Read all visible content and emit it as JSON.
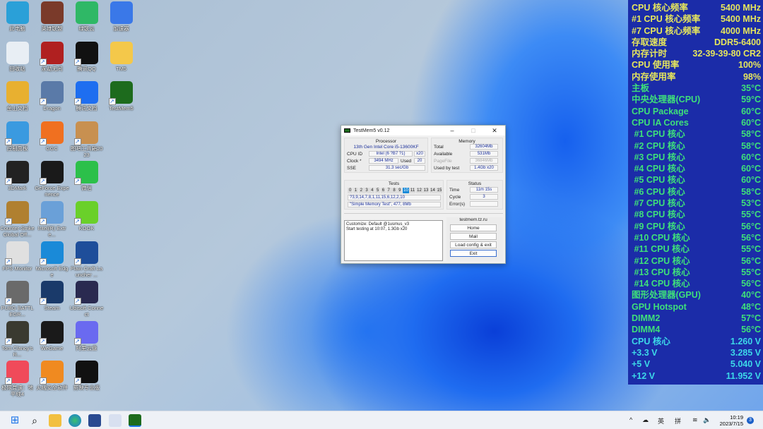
{
  "desktop_icons": [
    {
      "label": "此电脑",
      "color": "#2aa0d8"
    },
    {
      "label": "英雄联盟",
      "color": "#7a3a2a"
    },
    {
      "label": "绿联云",
      "color": "#2fb866"
    },
    {
      "label": "加速器",
      "color": "#3a78e8"
    },
    {
      "label": "回收站",
      "color": "#e8eef4"
    },
    {
      "label": "永劫无间",
      "color": "#b02020"
    },
    {
      "label": "腾讯QQ",
      "color": "#111111"
    },
    {
      "label": "TM5",
      "color": "#f4c84a"
    },
    {
      "label": "金山文档",
      "color": "#e8b030"
    },
    {
      "label": "Dragon",
      "color": "#5a7aa8"
    },
    {
      "label": "腾讯文档",
      "color": "#1e6ef0"
    },
    {
      "label": "TestMem5",
      "color": "#1d6b1d"
    },
    {
      "label": "控制面板",
      "color": "#3a9ae0"
    },
    {
      "label": "GGC",
      "color": "#f07020"
    },
    {
      "label": "图吧工具箱2023",
      "color": "#c89050"
    },
    {
      "label": "",
      "color": "transparent"
    },
    {
      "label": "3DMark",
      "color": "#222222"
    },
    {
      "label": "GeForce Experience",
      "color": "#1a1a1a"
    },
    {
      "label": "微信",
      "color": "#2cc04a"
    },
    {
      "label": "",
      "color": "transparent"
    },
    {
      "label": "Counter-Strike Global Off...",
      "color": "#b08030"
    },
    {
      "label": "Intel(R) Extre...",
      "color": "#6aa0d8"
    },
    {
      "label": "KOOK",
      "color": "#6ad02a"
    },
    {
      "label": "",
      "color": "transparent"
    },
    {
      "label": "FPS Monitor",
      "color": "#e0e0e0"
    },
    {
      "label": "Microsoft Edge",
      "color": "#1a8ad8"
    },
    {
      "label": "Plain Craft Launcher ...",
      "color": "#1e4e9a"
    },
    {
      "label": "",
      "color": "transparent"
    },
    {
      "label": "PUBG BATTLEGR...",
      "color": "#6a6a6a"
    },
    {
      "label": "Steam",
      "color": "#1a3a6a"
    },
    {
      "label": "Ubisoft Connect",
      "color": "#2a2a50"
    },
    {
      "label": "",
      "color": "transparent"
    },
    {
      "label": "Tom Clancy's R...",
      "color": "#3a3a30"
    },
    {
      "label": "WeGame",
      "color": "#1a1a1a"
    },
    {
      "label": "阿里云盘",
      "color": "#6a6af0"
    },
    {
      "label": "",
      "color": "transparent"
    },
    {
      "label": "极限竞速：地平线4",
      "color": "#f04a5a"
    },
    {
      "label": "火绒安全软件",
      "color": "#f08a20"
    },
    {
      "label": "剪映专业版",
      "color": "#111111"
    },
    {
      "label": "",
      "color": "transparent"
    }
  ],
  "window": {
    "title": "TestMem5 v0.12",
    "processor": {
      "heading": "Processor",
      "name": "13th Gen Intel Core i5-13600KF",
      "cpu_id_label": "CPU ID",
      "cpu_id": "Intel  (6 ?B7 ?1)",
      "threads": "x20",
      "clock_label": "Clock *",
      "clock": "3494 MHz",
      "used_label": "Used",
      "used": "20",
      "sse_label": "SSE",
      "sse": "31.3 sec/Gb"
    },
    "memory": {
      "heading": "Memory",
      "total_label": "Total",
      "total": "32604Mb",
      "available_label": "Available",
      "available": "531Mb",
      "pagefile_label": "PageFile",
      "pagefile": "36846Mb",
      "used_by_test_label": "Used by test",
      "used_by_test": "1.4Gb x20"
    },
    "tests": {
      "heading": "Tests",
      "numbers": [
        "0",
        "1",
        "2",
        "3",
        "4",
        "5",
        "6",
        "7",
        "8",
        "9",
        "10",
        "11",
        "12",
        "13",
        "14",
        "15"
      ],
      "active": 10,
      "sequence": "?3,9,14,7,8,1,11,15,6,12,2,10",
      "current": "\"Simple Memory Test\", 477, 8Mb"
    },
    "status": {
      "heading": "Status",
      "time_label": "Time",
      "time": "11m 15s",
      "cycle_label": "Cycle",
      "cycle": "3",
      "errors_label": "Error(s)",
      "errors": ""
    },
    "log": [
      "Customize: Default @1usmus_v3",
      "Start testing at 10:07, 1.3Gb x20"
    ],
    "site": "testmem.tz.ru",
    "buttons": {
      "home": "Home",
      "mail": "Mail",
      "load": "Load config & exit",
      "exit": "Exit"
    }
  },
  "monitor": {
    "colors": {
      "yellow": "#e6e65c",
      "green": "#3ee07a",
      "cyan": "#3cd8e8"
    },
    "rows": [
      {
        "label": "CPU 核心频率",
        "value": "5400 MHz",
        "c": "yellow"
      },
      {
        "label": "#1 CPU 核心频率",
        "value": "5400 MHz",
        "c": "yellow"
      },
      {
        "label": "#7 CPU 核心频率",
        "value": "4000 MHz",
        "c": "yellow"
      },
      {
        "label": "存取速度",
        "value": "DDR5-6400",
        "c": "yellow"
      },
      {
        "label": "内存计时",
        "value": "32-39-39-80 CR2",
        "c": "yellow"
      },
      {
        "label": "CPU 使用率",
        "value": "100%",
        "c": "yellow"
      },
      {
        "label": "内存使用率",
        "value": "98%",
        "c": "yellow"
      },
      {
        "label": "主板",
        "value": "35°C",
        "c": "green"
      },
      {
        "label": "中央处理器(CPU)",
        "value": "59°C",
        "c": "green"
      },
      {
        "label": "CPU Package",
        "value": "60°C",
        "c": "green"
      },
      {
        "label": "CPU IA Cores",
        "value": "60°C",
        "c": "green"
      },
      {
        "label": " #1 CPU 核心",
        "value": "58°C",
        "c": "green"
      },
      {
        "label": " #2 CPU 核心",
        "value": "58°C",
        "c": "green"
      },
      {
        "label": " #3 CPU 核心",
        "value": "60°C",
        "c": "green"
      },
      {
        "label": " #4 CPU 核心",
        "value": "60°C",
        "c": "green"
      },
      {
        "label": " #5 CPU 核心",
        "value": "60°C",
        "c": "green"
      },
      {
        "label": " #6 CPU 核心",
        "value": "58°C",
        "c": "green"
      },
      {
        "label": " #7 CPU 核心",
        "value": "53°C",
        "c": "green"
      },
      {
        "label": " #8 CPU 核心",
        "value": "55°C",
        "c": "green"
      },
      {
        "label": " #9 CPU 核心",
        "value": "56°C",
        "c": "green"
      },
      {
        "label": " #10 CPU 核心",
        "value": "56°C",
        "c": "green"
      },
      {
        "label": " #11 CPU 核心",
        "value": "55°C",
        "c": "green"
      },
      {
        "label": " #12 CPU 核心",
        "value": "56°C",
        "c": "green"
      },
      {
        "label": " #13 CPU 核心",
        "value": "55°C",
        "c": "green"
      },
      {
        "label": " #14 CPU 核心",
        "value": "56°C",
        "c": "green"
      },
      {
        "label": "图形处理器(GPU)",
        "value": "40°C",
        "c": "green"
      },
      {
        "label": "GPU Hotspot",
        "value": "48°C",
        "c": "green"
      },
      {
        "label": "DIMM2",
        "value": "57°C",
        "c": "green"
      },
      {
        "label": "DIMM4",
        "value": "56°C",
        "c": "green"
      },
      {
        "label": "CPU 核心",
        "value": "1.260 V",
        "c": "cyan"
      },
      {
        "label": "+3.3 V",
        "value": "3.285 V",
        "c": "cyan"
      },
      {
        "label": "+5 V",
        "value": "5.040 V",
        "c": "cyan"
      },
      {
        "label": "+12 V",
        "value": "11.952 V",
        "c": "cyan"
      }
    ]
  },
  "taskbar": {
    "ime_lang": "英",
    "ime_mode": "拼",
    "time": "10:19",
    "date": "2023/7/15",
    "notifications": "3"
  }
}
